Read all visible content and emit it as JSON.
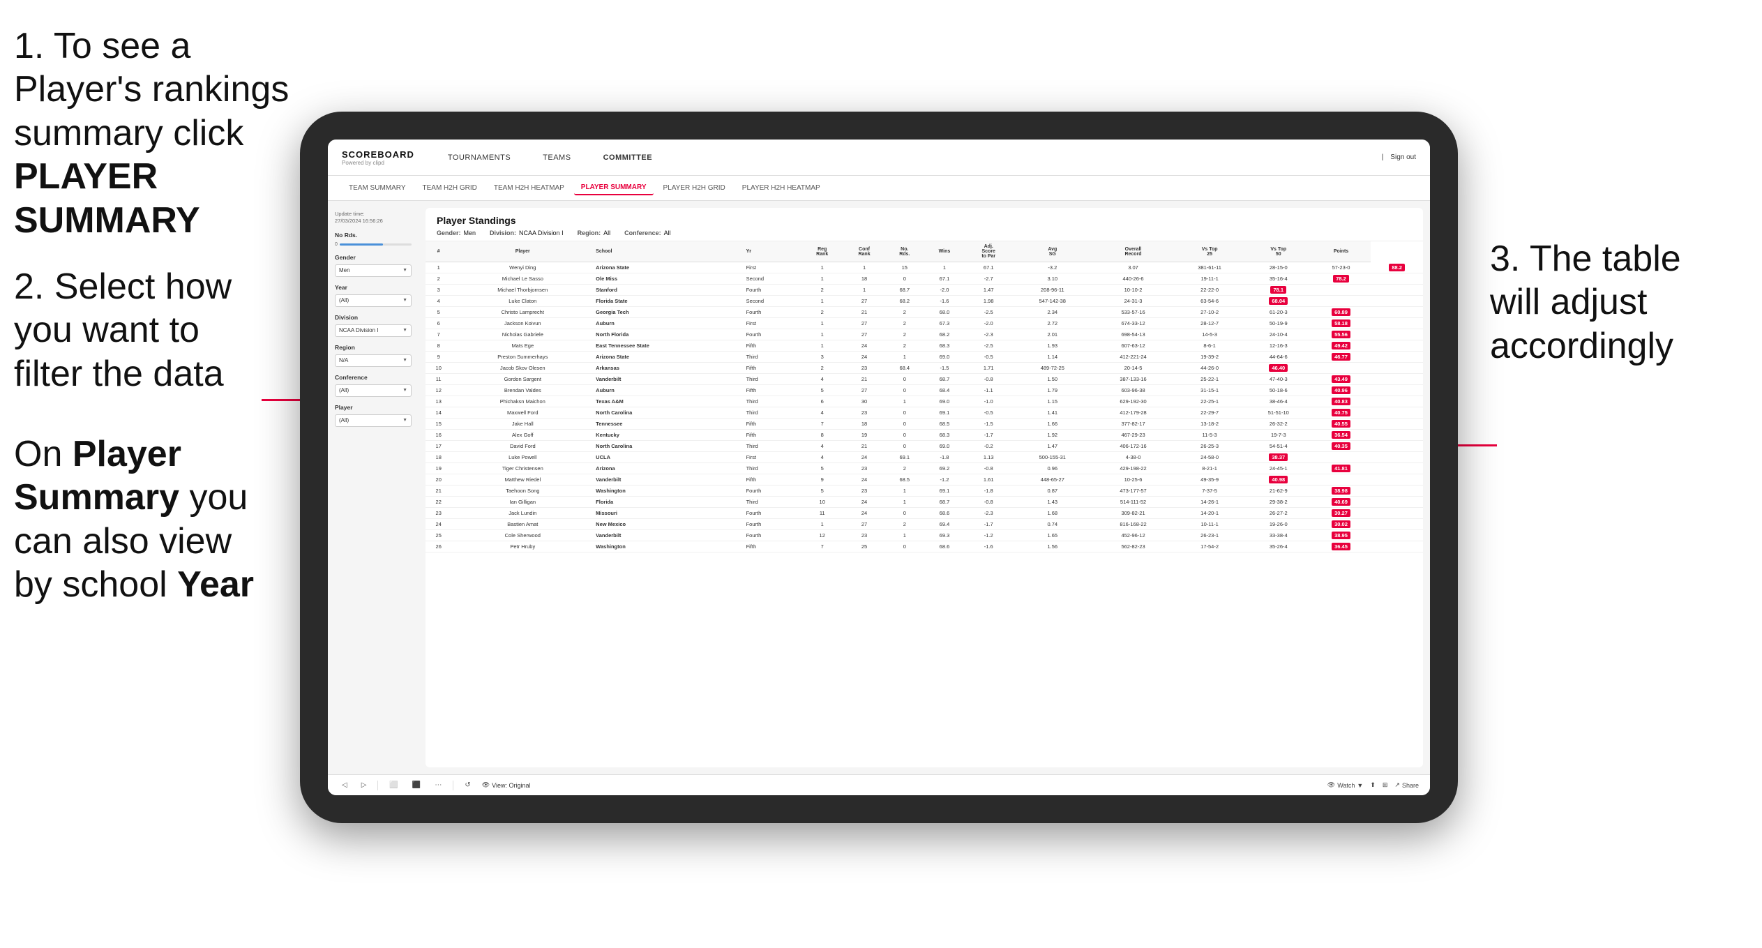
{
  "instructions": {
    "step1": "1. To see a Player's rankings summary click ",
    "step1_bold": "PLAYER SUMMARY",
    "step2": "2. Select how you want to filter the data",
    "step3": "3. The table will adjust accordingly",
    "note_prefix": "On ",
    "note_bold1": "Player Summary",
    "note_middle": " you can also view by school ",
    "note_bold2": "Year"
  },
  "nav": {
    "logo_main": "SCOREBOARD",
    "logo_sub": "Powered by clipd",
    "items": [
      "TOURNAMENTS",
      "TEAMS",
      "COMMITTEE"
    ],
    "sign_out": "Sign out"
  },
  "sub_nav": {
    "items": [
      "TEAM SUMMARY",
      "TEAM H2H GRID",
      "TEAM H2H HEATMAP",
      "PLAYER SUMMARY",
      "PLAYER H2H GRID",
      "PLAYER H2H HEATMAP"
    ],
    "active": "PLAYER SUMMARY"
  },
  "sidebar": {
    "update_label": "Update time:",
    "update_time": "27/03/2024 16:56:26",
    "no_rds_label": "No Rds.",
    "gender_label": "Gender",
    "gender_value": "Men",
    "year_label": "Year",
    "year_value": "(All)",
    "division_label": "Division",
    "division_value": "NCAA Division I",
    "region_label": "Region",
    "region_value": "N/A",
    "conference_label": "Conference",
    "conference_value": "(All)",
    "player_label": "Player",
    "player_value": "(All)"
  },
  "table": {
    "title": "Player Standings",
    "gender_label": "Gender:",
    "gender_val": "Men",
    "division_label": "Division:",
    "division_val": "NCAA Division I",
    "region_label": "Region:",
    "region_val": "All",
    "conference_label": "Conference:",
    "conference_val": "All",
    "columns": [
      "#",
      "Player",
      "School",
      "Yr",
      "Reg Rank",
      "Conf Rank",
      "No. Rds.",
      "Wins",
      "Adj. Score to Par",
      "Avg SG",
      "Overall Record",
      "Vs Top 25",
      "Vs Top 50",
      "Points"
    ],
    "rows": [
      [
        "1",
        "Wenyi Ding",
        "Arizona State",
        "First",
        "1",
        "1",
        "15",
        "1",
        "67.1",
        "-3.2",
        "3.07",
        "381-61-11",
        "28-15-0",
        "57-23-0",
        "88.2"
      ],
      [
        "2",
        "Michael Le Sasso",
        "Ole Miss",
        "Second",
        "1",
        "18",
        "0",
        "67.1",
        "-2.7",
        "3.10",
        "440-26-6",
        "19-11-1",
        "35-16-4",
        "78.2"
      ],
      [
        "3",
        "Michael Thorbjornsen",
        "Stanford",
        "Fourth",
        "2",
        "1",
        "68.7",
        "-2.0",
        "1.47",
        "208-96-11",
        "10-10-2",
        "22-22-0",
        "78.1"
      ],
      [
        "4",
        "Luke Claton",
        "Florida State",
        "Second",
        "1",
        "27",
        "68.2",
        "-1.6",
        "1.98",
        "547-142-38",
        "24-31-3",
        "63-54-6",
        "68.04"
      ],
      [
        "5",
        "Christo Lamprecht",
        "Georgia Tech",
        "Fourth",
        "2",
        "21",
        "2",
        "68.0",
        "-2.5",
        "2.34",
        "533-57-16",
        "27-10-2",
        "61-20-3",
        "60.89"
      ],
      [
        "6",
        "Jackson Koivun",
        "Auburn",
        "First",
        "1",
        "27",
        "2",
        "67.3",
        "-2.0",
        "2.72",
        "674-33-12",
        "28-12-7",
        "50-19-9",
        "58.18"
      ],
      [
        "7",
        "Nicholas Gabriele",
        "North Florida",
        "Fourth",
        "1",
        "27",
        "2",
        "68.2",
        "-2.3",
        "2.01",
        "698-54-13",
        "14-5-3",
        "24-10-4",
        "55.56"
      ],
      [
        "8",
        "Mats Ege",
        "East Tennessee State",
        "Fifth",
        "1",
        "24",
        "2",
        "68.3",
        "-2.5",
        "1.93",
        "607-63-12",
        "8-6-1",
        "12-16-3",
        "49.42"
      ],
      [
        "9",
        "Preston Summerhays",
        "Arizona State",
        "Third",
        "3",
        "24",
        "1",
        "69.0",
        "-0.5",
        "1.14",
        "412-221-24",
        "19-39-2",
        "44-64-6",
        "46.77"
      ],
      [
        "10",
        "Jacob Skov Olesen",
        "Arkansas",
        "Fifth",
        "2",
        "23",
        "68.4",
        "-1.5",
        "1.71",
        "489-72-25",
        "20-14-5",
        "44-26-0",
        "46.40"
      ],
      [
        "11",
        "Gordon Sargent",
        "Vanderbilt",
        "Third",
        "4",
        "21",
        "0",
        "68.7",
        "-0.8",
        "1.50",
        "387-133-16",
        "25-22-1",
        "47-40-3",
        "43.49"
      ],
      [
        "12",
        "Brendan Valdes",
        "Auburn",
        "Fifth",
        "5",
        "27",
        "0",
        "68.4",
        "-1.1",
        "1.79",
        "603-96-38",
        "31-15-1",
        "50-18-6",
        "40.96"
      ],
      [
        "13",
        "Phichaksn Maichon",
        "Texas A&M",
        "Third",
        "6",
        "30",
        "1",
        "69.0",
        "-1.0",
        "1.15",
        "629-192-30",
        "22-25-1",
        "38-46-4",
        "40.83"
      ],
      [
        "14",
        "Maxwell Ford",
        "North Carolina",
        "Third",
        "4",
        "23",
        "0",
        "69.1",
        "-0.5",
        "1.41",
        "412-179-28",
        "22-29-7",
        "51-51-10",
        "40.75"
      ],
      [
        "15",
        "Jake Hall",
        "Tennessee",
        "Fifth",
        "7",
        "18",
        "0",
        "68.5",
        "-1.5",
        "1.66",
        "377-82-17",
        "13-18-2",
        "26-32-2",
        "40.55"
      ],
      [
        "16",
        "Alex Goff",
        "Kentucky",
        "Fifth",
        "8",
        "19",
        "0",
        "68.3",
        "-1.7",
        "1.92",
        "467-29-23",
        "11-5-3",
        "19-7-3",
        "36.54"
      ],
      [
        "17",
        "David Ford",
        "North Carolina",
        "Third",
        "4",
        "21",
        "0",
        "69.0",
        "-0.2",
        "1.47",
        "406-172-16",
        "26-25-3",
        "54-51-4",
        "40.35"
      ],
      [
        "18",
        "Luke Powell",
        "UCLA",
        "First",
        "4",
        "24",
        "69.1",
        "-1.8",
        "1.13",
        "500-155-31",
        "4-38-0",
        "24-58-0",
        "38.37"
      ],
      [
        "19",
        "Tiger Christensen",
        "Arizona",
        "Third",
        "5",
        "23",
        "2",
        "69.2",
        "-0.8",
        "0.96",
        "429-198-22",
        "8-21-1",
        "24-45-1",
        "41.81"
      ],
      [
        "20",
        "Matthew Riedel",
        "Vanderbilt",
        "Fifth",
        "9",
        "24",
        "68.5",
        "-1.2",
        "1.61",
        "448-65-27",
        "10-25-6",
        "49-35-9",
        "40.98"
      ],
      [
        "21",
        "Taehoon Song",
        "Washington",
        "Fourth",
        "5",
        "23",
        "1",
        "69.1",
        "-1.8",
        "0.87",
        "473-177-57",
        "7-37-5",
        "21-62-9",
        "38.98"
      ],
      [
        "22",
        "Ian Gilligan",
        "Florida",
        "Third",
        "10",
        "24",
        "1",
        "68.7",
        "-0.8",
        "1.43",
        "514-111-52",
        "14-26-1",
        "29-38-2",
        "40.69"
      ],
      [
        "23",
        "Jack Lundin",
        "Missouri",
        "Fourth",
        "11",
        "24",
        "0",
        "68.6",
        "-2.3",
        "1.68",
        "309-82-21",
        "14-20-1",
        "26-27-2",
        "30.27"
      ],
      [
        "24",
        "Bastien Amat",
        "New Mexico",
        "Fourth",
        "1",
        "27",
        "2",
        "69.4",
        "-1.7",
        "0.74",
        "816-168-22",
        "10-11-1",
        "19-26-0",
        "30.02"
      ],
      [
        "25",
        "Cole Sherwood",
        "Vanderbilt",
        "Fourth",
        "12",
        "23",
        "1",
        "69.3",
        "-1.2",
        "1.65",
        "452-96-12",
        "26-23-1",
        "33-38-4",
        "38.95"
      ],
      [
        "26",
        "Petr Hruby",
        "Washington",
        "Fifth",
        "7",
        "25",
        "0",
        "68.6",
        "-1.6",
        "1.56",
        "562-82-23",
        "17-54-2",
        "35-26-4",
        "36.45"
      ]
    ]
  },
  "toolbar": {
    "view_label": "View: Original",
    "watch_label": "Watch",
    "share_label": "Share"
  }
}
